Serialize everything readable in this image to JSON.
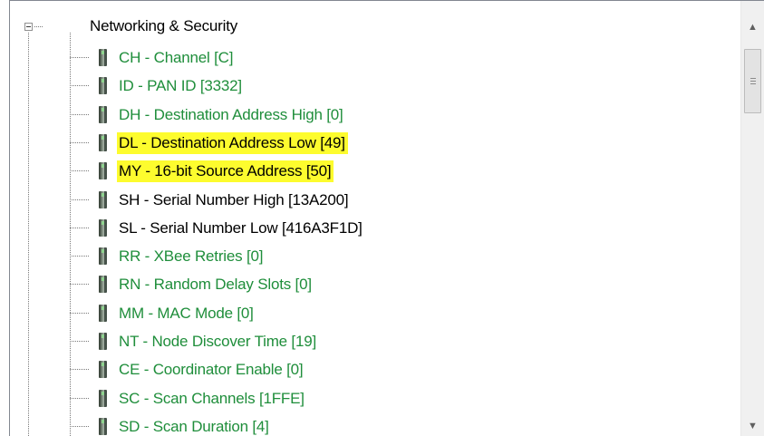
{
  "tree": {
    "group": {
      "label": "Networking & Security",
      "expanded": true
    },
    "items": [
      {
        "label": "CH - Channel [C]",
        "color": "#1f8e3b",
        "highlight": false
      },
      {
        "label": "ID - PAN ID [3332]",
        "color": "#1f8e3b",
        "highlight": false
      },
      {
        "label": "DH - Destination Address High [0]",
        "color": "#1f8e3b",
        "highlight": false
      },
      {
        "label": "DL - Destination Address Low [49]",
        "color": "#000000",
        "highlight": true
      },
      {
        "label": "MY - 16-bit Source Address [50]",
        "color": "#000000",
        "highlight": true
      },
      {
        "label": "SH - Serial Number High [13A200]",
        "color": "#000000",
        "highlight": false
      },
      {
        "label": "SL - Serial Number Low [416A3F1D]",
        "color": "#000000",
        "highlight": false
      },
      {
        "label": "RR - XBee Retries [0]",
        "color": "#1f8e3b",
        "highlight": false
      },
      {
        "label": "RN - Random Delay Slots [0]",
        "color": "#1f8e3b",
        "highlight": false
      },
      {
        "label": "MM - MAC Mode [0]",
        "color": "#1f8e3b",
        "highlight": false
      },
      {
        "label": "NT - Node Discover Time [19]",
        "color": "#1f8e3b",
        "highlight": false
      },
      {
        "label": "CE - Coordinator Enable [0]",
        "color": "#1f8e3b",
        "highlight": false
      },
      {
        "label": "SC - Scan Channels [1FFE]",
        "color": "#1f8e3b",
        "highlight": false
      },
      {
        "label": "SD - Scan Duration [4]",
        "color": "#1f8e3b",
        "highlight": false
      }
    ]
  },
  "colors": {
    "modified_value": "#1f8e3b",
    "default_value": "#000000",
    "highlight": "#fdfc2e"
  },
  "icons": {
    "expander": "minus-box-icon",
    "node": "xbee-module-icon",
    "scroll_up": "arrow-up-icon",
    "scroll_down": "arrow-down-icon"
  }
}
